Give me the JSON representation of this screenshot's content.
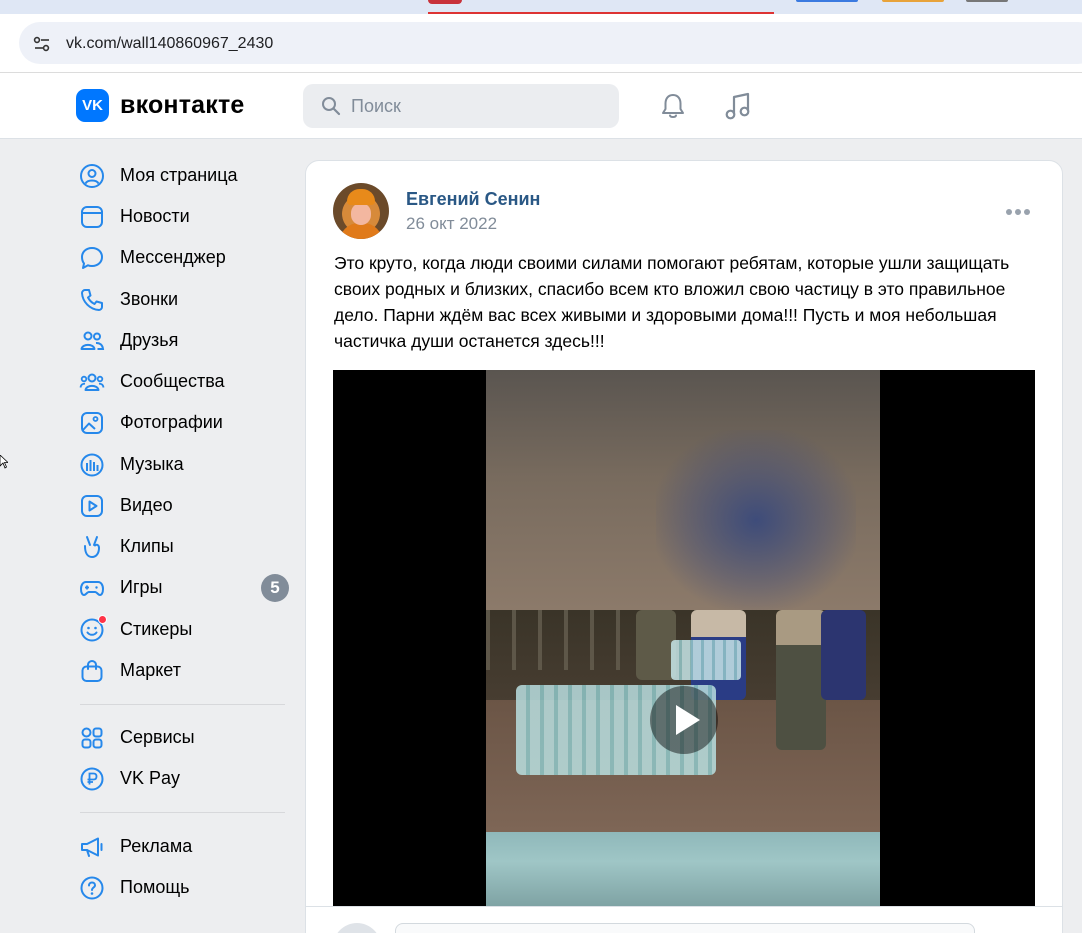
{
  "browser": {
    "url": "vk.com/wall140860967_2430"
  },
  "header": {
    "logo_text": "VK",
    "brand": "вконтакте",
    "search_placeholder": "Поиск",
    "accent_color": "#0077ff"
  },
  "sidebar": {
    "items": [
      {
        "label": "Моя страница",
        "icon": "user-circle-icon"
      },
      {
        "label": "Новости",
        "icon": "news-icon"
      },
      {
        "label": "Мессенджер",
        "icon": "message-bubble-icon"
      },
      {
        "label": "Звонки",
        "icon": "phone-icon"
      },
      {
        "label": "Друзья",
        "icon": "friends-icon"
      },
      {
        "label": "Сообщества",
        "icon": "communities-icon"
      },
      {
        "label": "Фотографии",
        "icon": "photo-icon"
      },
      {
        "label": "Музыка",
        "icon": "music-bars-icon"
      },
      {
        "label": "Видео",
        "icon": "video-icon"
      },
      {
        "label": "Клипы",
        "icon": "clips-icon"
      },
      {
        "label": "Игры",
        "icon": "gamepad-icon",
        "badge": "5"
      },
      {
        "label": "Стикеры",
        "icon": "sticker-smile-icon"
      },
      {
        "label": "Маркет",
        "icon": "shopping-bag-icon"
      }
    ],
    "items2": [
      {
        "label": "Сервисы",
        "icon": "grid-icon"
      },
      {
        "label": "VK Pay",
        "icon": "ruble-icon"
      }
    ],
    "items3": [
      {
        "label": "Реклама",
        "icon": "megaphone-icon"
      },
      {
        "label": "Помощь",
        "icon": "help-icon"
      }
    ]
  },
  "post": {
    "author": "Евгений Сенин",
    "date": "26 окт 2022",
    "text": "Это круто, когда люди своими силами помогают ребятам, которые ушли защищать своих родных и близких, спасибо всем кто вложил свою частицу в это правильное дело. Парни ждём вас всех живыми и здоровыми дома!!! Пусть и моя небольшая частичка души останется здесь!!!",
    "author_color": "#2a5885"
  }
}
